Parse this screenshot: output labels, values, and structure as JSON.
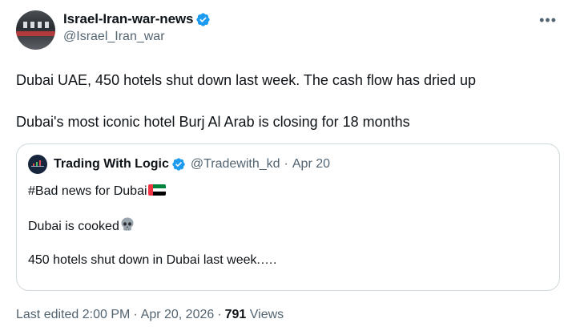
{
  "author": {
    "display_name": "Israel-Iran-war-news",
    "handle": "@Israel_Iran_war",
    "verified": true
  },
  "more_icon": "more-dots-icon",
  "tweet_text": {
    "line1": "Dubai UAE, 450 hotels shut down last week. The cash flow has dried up",
    "line2": "Dubai's most iconic hotel Burj Al Arab is closing for 18 months"
  },
  "quote": {
    "display_name": "Trading With Logic",
    "handle": "@Tradewith_kd",
    "separator": "·",
    "date": "Apr 20",
    "verified": true,
    "line1": "#Bad news for Dubai",
    "line1_emoji": "flag-uae-icon",
    "line2": "Dubai is cooked",
    "line2_emoji": "skull-icon",
    "line3": "450 hotels shut down in Dubai last week.…."
  },
  "footer": {
    "edited": "Last edited 2:00 PM",
    "separator": "·",
    "date": "Apr 20, 2026",
    "views_count": "791",
    "views_label": "Views"
  },
  "colors": {
    "verified_blue": "#1d9bf0",
    "secondary_text": "#536471",
    "border": "#cfd9de"
  }
}
